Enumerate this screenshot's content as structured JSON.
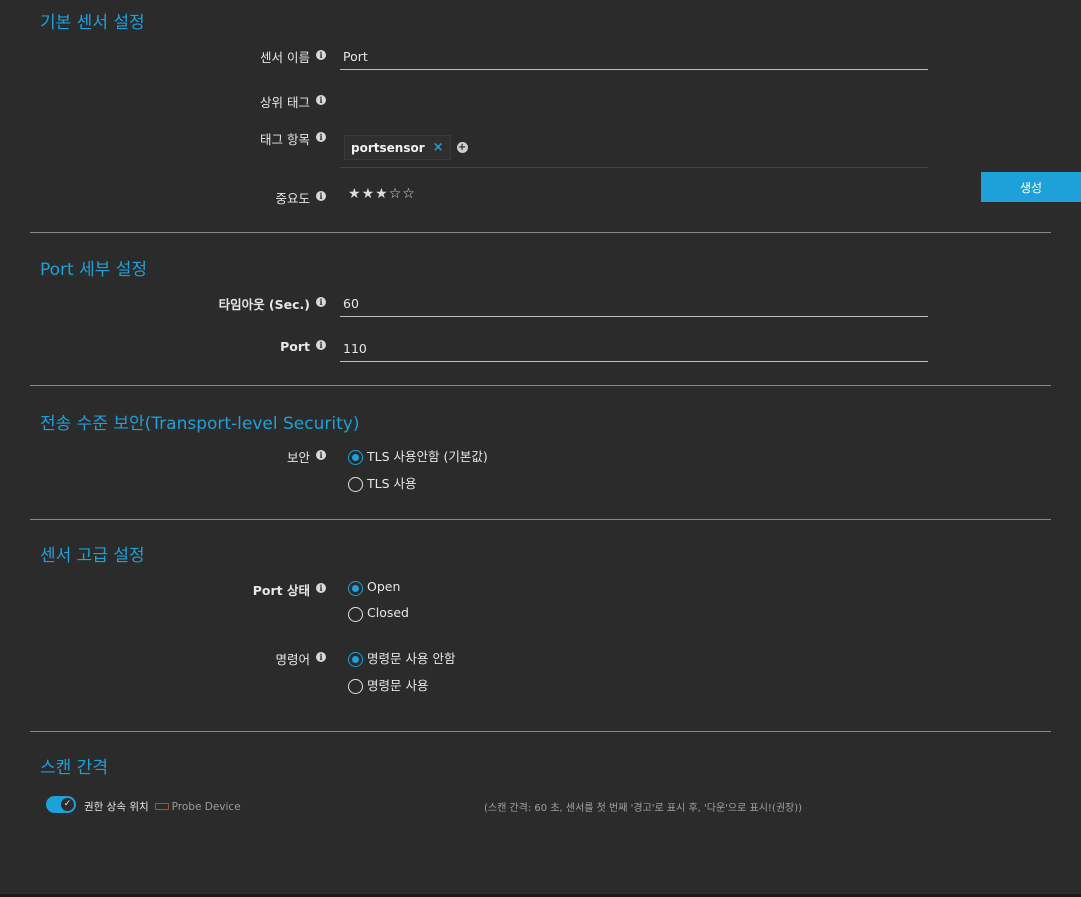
{
  "basic": {
    "title": "기본 센서 설정",
    "sensor_name_label": "센서 이름",
    "sensor_name_value": "Port",
    "parent_tags_label": "상위 태그",
    "tags_label": "태그 항목",
    "tag_value": "portsensor",
    "tag_remove": "×",
    "priority_label": "중요도",
    "priority_value": 3,
    "priority_max": 5,
    "create_button": "생성"
  },
  "port": {
    "title": "Port 세부 설정",
    "timeout_label": "타임아웃 (Sec.)",
    "timeout_value": "60",
    "port_label": "Port",
    "port_value": "110"
  },
  "tls": {
    "title": "전송 수준 보안(Transport-level Security)",
    "security_label": "보안",
    "options": [
      "TLS 사용안함 (기본값)",
      "TLS 사용"
    ],
    "selected": 0
  },
  "advanced": {
    "title": "센서 고급 설정",
    "port_state_label": "Port 상태",
    "port_state_options": [
      "Open",
      "Closed"
    ],
    "port_state_selected": 0,
    "command_label": "명령어",
    "command_options": [
      "명령문 사용 안함",
      "명령문 사용"
    ],
    "command_selected": 0
  },
  "scan": {
    "title": "스캔 간격",
    "inherit_label": "권한 상속 위치",
    "inherit_source": "Probe Device",
    "note": "(스캔 간격: 60 초, 센서를 첫 번째 '경고'로 표시 후, '다운'으로 표시!(권장))"
  },
  "colors": {
    "accent": "#1ea0d8",
    "background": "#2b2b2b"
  }
}
